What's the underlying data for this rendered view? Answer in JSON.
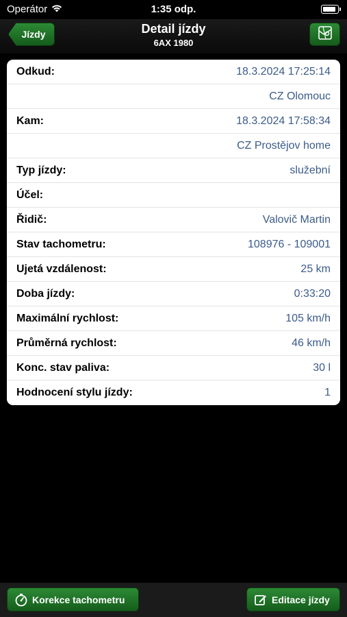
{
  "status_bar": {
    "carrier": "Operátor",
    "time": "1:35 odp."
  },
  "nav": {
    "back_label": "Jízdy",
    "title": "Detail jízdy",
    "subtitle": "6AX 1980"
  },
  "details": [
    {
      "label": "Odkud:",
      "value": "18.3.2024 17:25:14"
    },
    {
      "label": "",
      "value": "CZ Olomouc"
    },
    {
      "label": "Kam:",
      "value": "18.3.2024 17:58:34"
    },
    {
      "label": "",
      "value": "CZ Prostějov home"
    },
    {
      "label": "Typ jízdy:",
      "value": "služební"
    },
    {
      "label": "Účel:",
      "value": ""
    },
    {
      "label": "Řidič:",
      "value": "Valovič Martin"
    },
    {
      "label": "Stav tachometru:",
      "value": "108976 - 109001"
    },
    {
      "label": "Ujetá vzdálenost:",
      "value": "25 km"
    },
    {
      "label": "Doba jízdy:",
      "value": "0:33:20"
    },
    {
      "label": "Maximální rychlost:",
      "value": "105 km/h"
    },
    {
      "label": "Průměrná rychlost:",
      "value": "46 km/h"
    },
    {
      "label": "Konc. stav paliva:",
      "value": "30 l"
    },
    {
      "label": "Hodnocení stylu jízdy:",
      "value": "1"
    }
  ],
  "toolbar": {
    "odometer_label": "Korekce tachometru",
    "edit_label": "Editace jízdy"
  },
  "colors": {
    "accent_green": "#1f7a29",
    "value_blue": "#3b5b8a"
  },
  "icons": [
    "wifi-icon",
    "battery-icon",
    "map-icon",
    "odometer-icon",
    "edit-icon"
  ]
}
